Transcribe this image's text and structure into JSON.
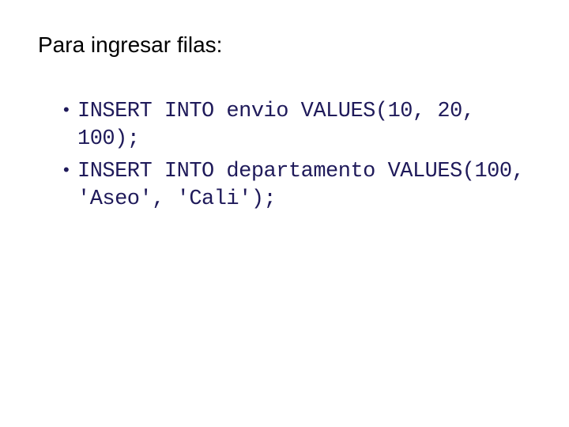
{
  "title": "Para ingresar filas:",
  "items": [
    "INSERT INTO envio VALUES(10, 20, 100);",
    "INSERT INTO departamento VALUES(100, 'Aseo', 'Cali');"
  ]
}
